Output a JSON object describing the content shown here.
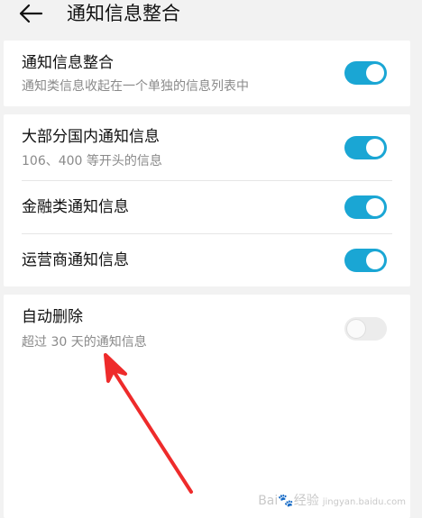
{
  "header": {
    "back_icon": "arrow-left-icon",
    "title": "通知信息整合"
  },
  "settings": [
    {
      "title": "通知信息整合",
      "subtitle": "通知类信息收起在一个单独的信息列表中",
      "enabled": true
    },
    {
      "title": "大部分国内通知信息",
      "subtitle": "106、400 等开头的信息",
      "enabled": true
    },
    {
      "title": "金融类通知信息",
      "enabled": true
    },
    {
      "title": "运营商通知信息",
      "enabled": true
    },
    {
      "title": "自动删除",
      "subtitle": "超过 30 天的通知信息",
      "enabled": false
    }
  ],
  "watermark": {
    "brand": "Bai",
    "brand_suffix": "经验",
    "url": "jingyan.baidu.com"
  },
  "colors": {
    "toggle_on": "#1aa6d4",
    "toggle_off": "#ececec",
    "annotation_arrow": "#ee2b2b"
  }
}
